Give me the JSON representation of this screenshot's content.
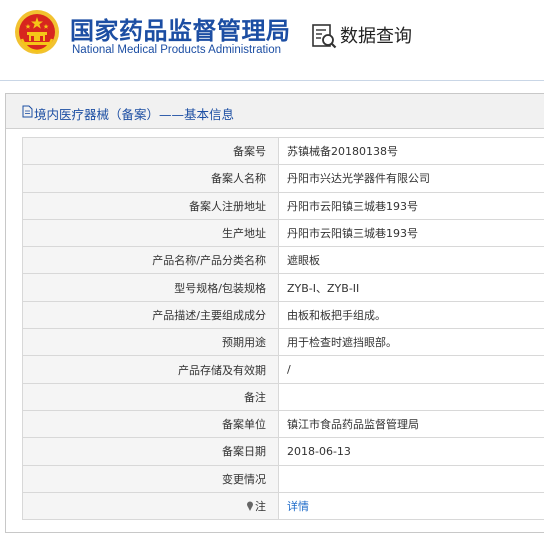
{
  "header": {
    "title_cn": "国家药品监督管理局",
    "title_en": "National Medical Products Administration",
    "search_title": "数据查询",
    "emblem_icon": "national-emblem-icon",
    "search_icon": "document-search-icon"
  },
  "panel": {
    "title": "境内医疗器械（备案）——基本信息",
    "icon": "document-icon"
  },
  "rows": [
    {
      "label": "备案号",
      "value": "苏镇械备20180138号"
    },
    {
      "label": "备案人名称",
      "value": "丹阳市兴达光学器件有限公司"
    },
    {
      "label": "备案人注册地址",
      "value": "丹阳市云阳镇三城巷193号"
    },
    {
      "label": "生产地址",
      "value": "丹阳市云阳镇三城巷193号"
    },
    {
      "label": "产品名称/产品分类名称",
      "value": "遮眼板"
    },
    {
      "label": "型号规格/包装规格",
      "value": "ZYB-I、ZYB-II"
    },
    {
      "label": "产品描述/主要组成成分",
      "value": "由板和板把手组成。"
    },
    {
      "label": "预期用途",
      "value": "用于检查时遮挡眼部。"
    },
    {
      "label": "产品存储及有效期",
      "value": "/"
    },
    {
      "label": "备注",
      "value": ""
    },
    {
      "label": "备案单位",
      "value": "镇江市食品药品监督管理局"
    },
    {
      "label": "备案日期",
      "value": "2018-06-13"
    },
    {
      "label": "变更情况",
      "value": ""
    },
    {
      "label": "注",
      "value": "详情"
    }
  ],
  "colors": {
    "brand": "#1c4ea3",
    "link": "#1c6ac9",
    "emblem_red": "#d7261e",
    "emblem_gold": "#f5c518"
  }
}
